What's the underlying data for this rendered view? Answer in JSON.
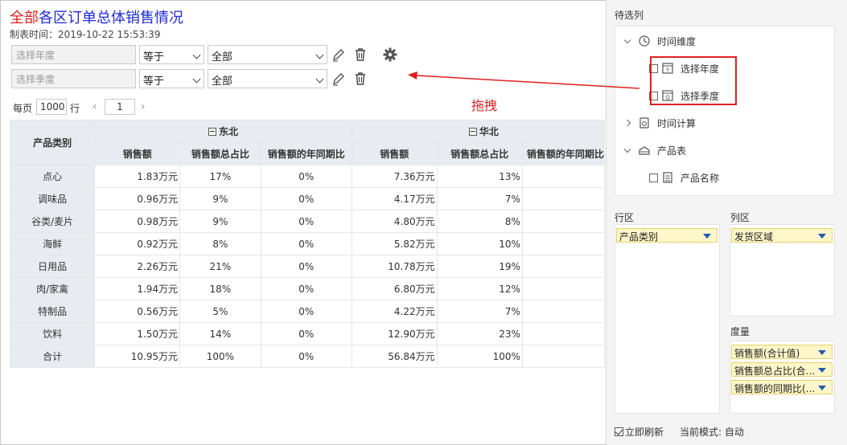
{
  "report": {
    "title_highlight": "全部",
    "title_rest": "各区订单总体销售情况",
    "created_at": "制表时间：2019-10-22 15:53:39"
  },
  "filters": [
    {
      "placeholder": "选择年度",
      "operator": "等于",
      "value": "全部"
    },
    {
      "placeholder": "选择季度",
      "operator": "等于",
      "value": "全部"
    }
  ],
  "pager": {
    "per_page_label": "每页",
    "per_page_value": "1000",
    "rows_unit": "行",
    "page": "1",
    "prev": "‹",
    "next": "›"
  },
  "annotation": {
    "drag_label": "拖拽"
  },
  "table": {
    "row_header": "产品类别",
    "groups": [
      "东北",
      "华北"
    ],
    "measures": [
      "销售额",
      "销售额总占比",
      "销售额的年同期比"
    ],
    "rows": [
      {
        "cat": "点心",
        "v": [
          "1.83万元",
          "17%",
          "0%",
          "7.36万元",
          "13%"
        ]
      },
      {
        "cat": "调味品",
        "v": [
          "0.96万元",
          "9%",
          "0%",
          "4.17万元",
          "7%"
        ]
      },
      {
        "cat": "谷类/麦片",
        "v": [
          "0.98万元",
          "9%",
          "0%",
          "4.80万元",
          "8%"
        ]
      },
      {
        "cat": "海鲜",
        "v": [
          "0.92万元",
          "8%",
          "0%",
          "5.82万元",
          "10%"
        ]
      },
      {
        "cat": "日用品",
        "v": [
          "2.26万元",
          "21%",
          "0%",
          "10.78万元",
          "19%"
        ]
      },
      {
        "cat": "肉/家禽",
        "v": [
          "1.94万元",
          "18%",
          "0%",
          "6.80万元",
          "12%"
        ]
      },
      {
        "cat": "特制品",
        "v": [
          "0.56万元",
          "5%",
          "0%",
          "4.22万元",
          "7%"
        ]
      },
      {
        "cat": "饮料",
        "v": [
          "1.50万元",
          "14%",
          "0%",
          "12.90万元",
          "23%"
        ]
      },
      {
        "cat": "合计",
        "v": [
          "10.95万元",
          "100%",
          "0%",
          "56.84万元",
          "100%"
        ]
      }
    ]
  },
  "panel": {
    "title": "待选列",
    "tree": [
      {
        "label": "时间维度"
      },
      {
        "label": "选择年度"
      },
      {
        "label": "选择季度"
      },
      {
        "label": "时间计算"
      },
      {
        "label": "产品表"
      },
      {
        "label": "产品名称"
      }
    ],
    "row_zone_label": "行区",
    "col_zone_label": "列区",
    "measure_zone_label": "度量",
    "row_pill": "产品类别",
    "col_pill": "发货区域",
    "measure_pills": [
      "销售额(合计值)",
      "销售额总占比(合...",
      "销售额的同期比(..."
    ],
    "auto_refresh": "立即刷新",
    "mode": "当前模式: 自动"
  },
  "colors": {
    "accent_red": "#e02020",
    "title_blue": "#1f2ad8",
    "pill_bg": "#fdf6c8",
    "header_bg": "#e8ecf1"
  }
}
